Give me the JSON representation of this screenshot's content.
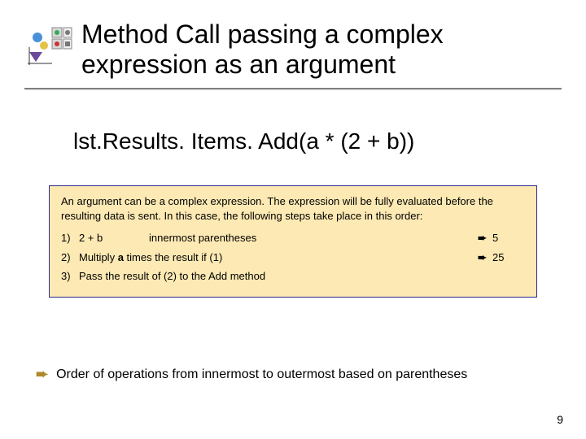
{
  "title": "Method Call passing a complex expression as an argument",
  "code": "lst.Results. Items. Add(a * (2 + b))",
  "callout": {
    "intro": "An argument can be a complex expression. The expression will be fully evaluated before the resulting data is sent. In this case, the following steps take place in this order:",
    "steps": [
      {
        "num": "1)",
        "left": "2 + b",
        "mid": "innermost parentheses",
        "arrow": "➨",
        "result": "5"
      },
      {
        "num": "2)",
        "left": "Multiply ",
        "mid_html": "a_bold_times_result",
        "arrow": "➨",
        "result": "25"
      },
      {
        "num": "3)",
        "full": "Pass the result of (2) to the Add method"
      }
    ],
    "step2_prefix": "Multiply ",
    "step2_bold": "a",
    "step2_suffix": " times  the result if (1)"
  },
  "footer_bullet": "Order of operations from innermost to outermost based on parentheses",
  "page_number": "9"
}
